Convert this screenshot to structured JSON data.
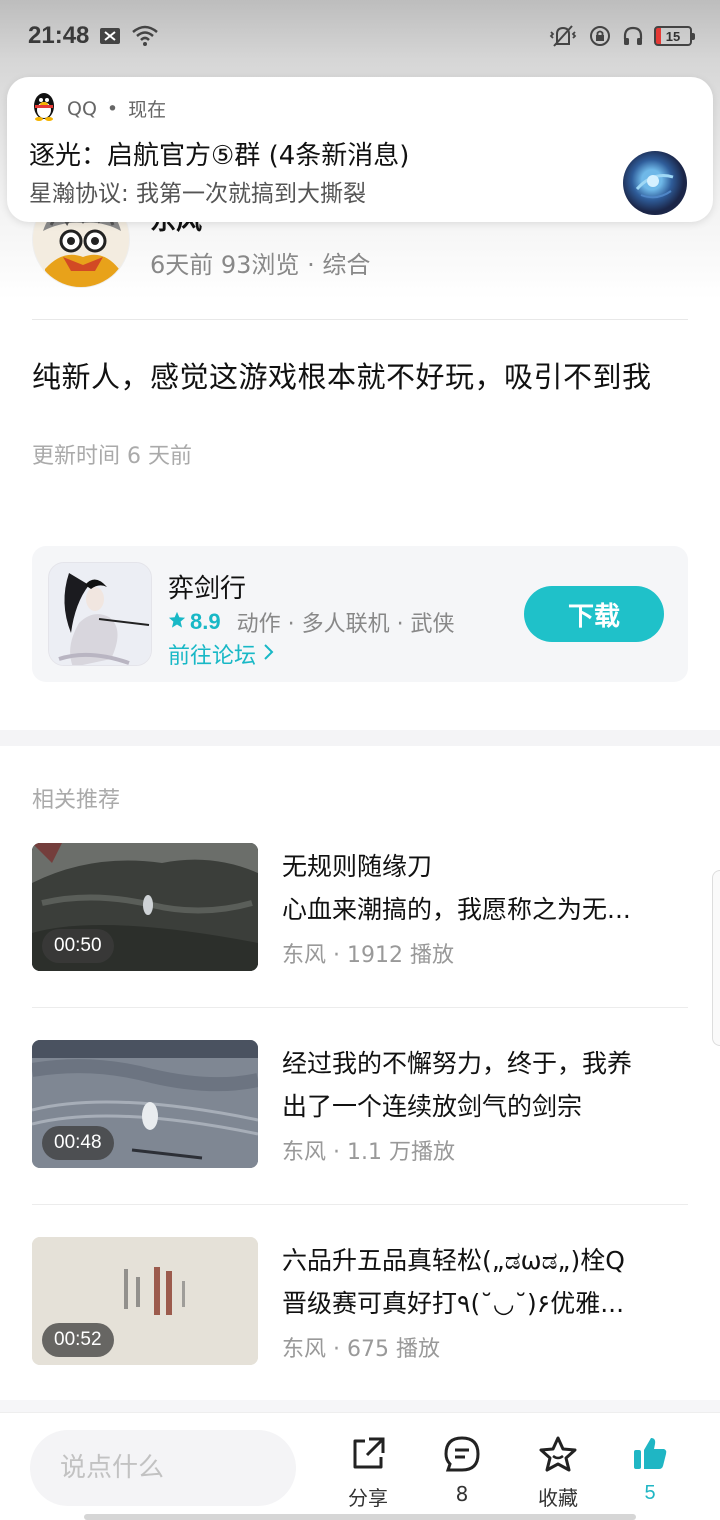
{
  "status_bar": {
    "time": "21:48",
    "battery": "15"
  },
  "notification": {
    "app": "QQ",
    "when": "现在",
    "separator": "•",
    "title": "逐光：启航官方⑤群 (4条新消息)",
    "body": "星瀚协议: 我第一次就搞到大撕裂"
  },
  "post": {
    "author": "东风",
    "meta": "6天前  93浏览 · 综合",
    "content": "纯新人，感觉这游戏根本就不好玩，吸引不到我",
    "updated": "更新时间 6 天前"
  },
  "game_card": {
    "name": "弈剑行",
    "rating": "8.9",
    "tags": "动作 · 多人联机 · 武侠",
    "forum_link": "前往论坛",
    "download_label": "下载",
    "accent_color": "#1fc1c9"
  },
  "related": {
    "title": "相关推荐",
    "items": [
      {
        "duration": "00:50",
        "title_line1": "无规则随缘刀",
        "title_line2": "心血来潮搞的，我愿称之为无...",
        "author": "东风",
        "plays": "1912 播放"
      },
      {
        "duration": "00:48",
        "title_line1": "经过我的不懈努力，终于，我养",
        "title_line2": "出了一个连续放剑气的剑宗",
        "author": "东风",
        "plays": "1.1 万播放"
      },
      {
        "duration": "00:52",
        "title_line1": "六品升五品真轻松(„ಡωಡ„)栓Q",
        "title_line2": "晋级赛可真好打٩(˘◡˘)۶优雅...",
        "author": "东风",
        "plays": "675 播放"
      }
    ]
  },
  "bottom_bar": {
    "comment_placeholder": "说点什么",
    "share_label": "分享",
    "comment_count": "8",
    "favorite_label": "收藏",
    "like_count": "5"
  }
}
